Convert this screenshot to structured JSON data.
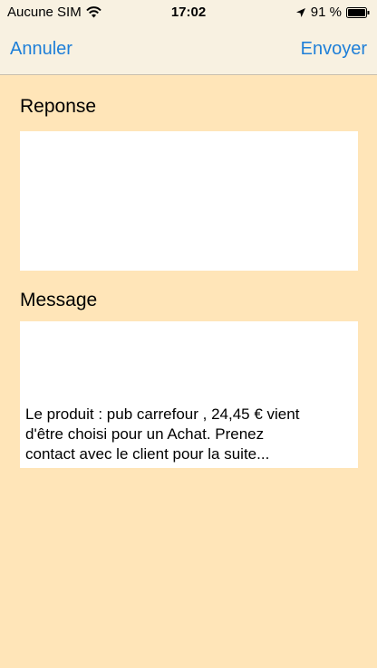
{
  "status_bar": {
    "carrier": "Aucune SIM",
    "time": "17:02",
    "battery": "91 %",
    "icons": [
      "wifi-icon",
      "location-icon",
      "battery-icon"
    ]
  },
  "nav": {
    "cancel_label": "Annuler",
    "send_label": "Envoyer"
  },
  "form": {
    "response_label": "Reponse",
    "response_value": "",
    "message_label": "Message",
    "message_value": "Le produit : pub carrefour , 24,45 € vient\nd'être choisi pour un Achat. Prenez\ncontact avec le client pour la suite..."
  },
  "colors": {
    "background": "#FFE5B8",
    "nav_background": "#F8F1E1",
    "accent": "#1E7FD8"
  }
}
